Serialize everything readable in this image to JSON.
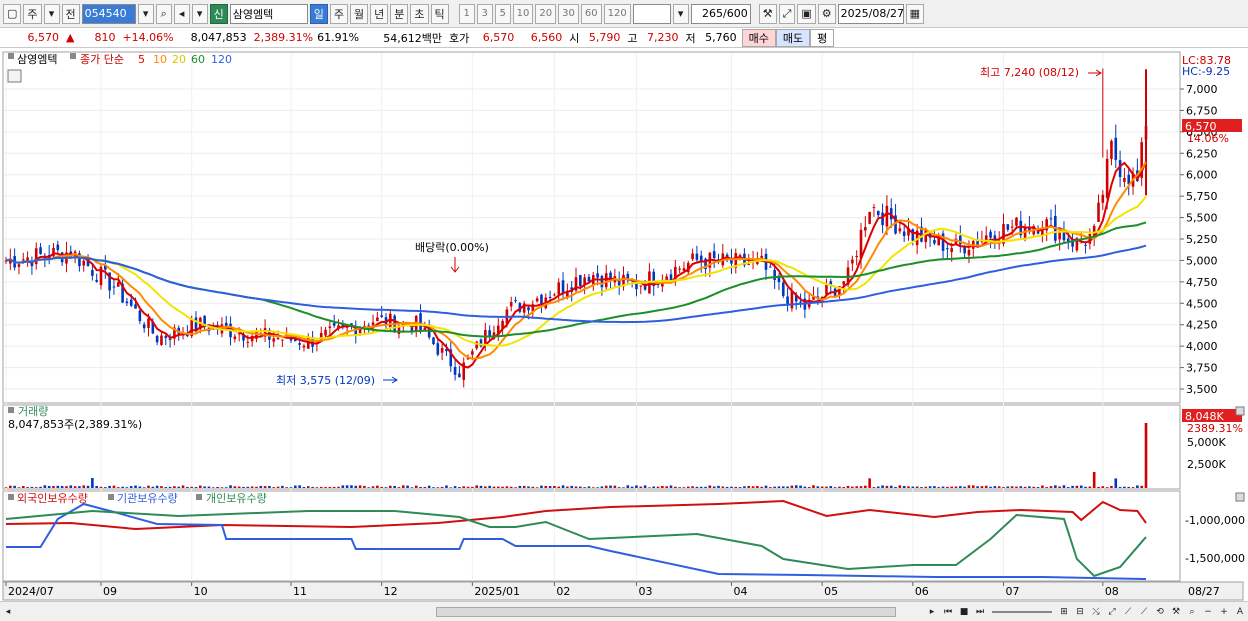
{
  "toolbar": {
    "market_label": "주",
    "all_label": "전",
    "stock_code": "054540",
    "new_badge": "신",
    "stock_name": "삼영엠텍",
    "periods": [
      "일",
      "주",
      "월",
      "년",
      "분",
      "초",
      "틱"
    ],
    "active_period": "일",
    "intervals": [
      "1",
      "3",
      "5",
      "10",
      "20",
      "30",
      "60",
      "120"
    ],
    "count_value": "265",
    "count_max": "/600",
    "date_value": "2025/08/27",
    "icons": [
      "window-icon",
      "dropdown-icon",
      "search-icon",
      "speaker-icon",
      "tools-icon",
      "draw-icon",
      "save-icon",
      "gear-icon",
      "calendar-icon"
    ]
  },
  "quote": {
    "price": "6,570",
    "change_arrow": "▲",
    "change": "810",
    "change_pct": "+14.06%",
    "volume": "8,047,853",
    "volume_ratio": "2,389.31%",
    "turnover": "61.91%",
    "amount": "54,612백만",
    "bid_label": "호가",
    "ask_price": "6,570",
    "bid_price": "6,560",
    "open_label": "시",
    "open": "5,790",
    "high_label": "고",
    "high": "7,230",
    "low_label": "저",
    "low": "5,760",
    "buy_label": "매수",
    "sell_label": "매도",
    "eval_label": "평"
  },
  "colors": {
    "up": "#d00000",
    "down": "#0036c0",
    "ma5": "#e00000",
    "ma10": "#ff8c00",
    "ma20": "#f2e400",
    "ma60": "#1a8f2a",
    "ma120": "#2f5fe0",
    "foreign": "#d01010",
    "institution": "#2f5fe0",
    "individual": "#2e8b57",
    "current_price_bg": "#e02020"
  },
  "price_panel": {
    "stock_label": "삼영엠텍",
    "ma_prefix": "종가 단순",
    "ma_periods": [
      "5",
      "10",
      "20",
      "60",
      "120"
    ],
    "lc_label": "LC:83.78",
    "hc_label": "HC:-9.25",
    "high_annotation": "최고 7,240 (08/12)",
    "low_annotation": "최저 3,575 (12/09)",
    "dividend_annotation": "배당락(0.00%)",
    "current_price": "6,570",
    "current_change": "14.06%",
    "y_ticks": [
      "7,000",
      "6,750",
      "6,500",
      "6,250",
      "6,000",
      "5,750",
      "5,500",
      "5,250",
      "5,000",
      "4,750",
      "4,500",
      "4,250",
      "4,000",
      "3,750",
      "3,500"
    ]
  },
  "volume_panel": {
    "title": "거래량",
    "value_label": "8,047,853주(2,389.31%)",
    "current": "8,048K",
    "current_pct": "2389.31%",
    "y_ticks": [
      "5,000K",
      "2,500K"
    ]
  },
  "holdings_panel": {
    "foreign_label": "외국인보유수량",
    "institution_label": "기관보유수량",
    "individual_label": "개인보유수량",
    "y_ticks": [
      "-1,000,000",
      "-1,500,000"
    ]
  },
  "x_axis": {
    "labels": [
      "2024/07",
      "09",
      "10",
      "11",
      "12",
      "2025/01",
      "02",
      "03",
      "04",
      "05",
      "06",
      "07",
      "08"
    ],
    "last_date": "08/27"
  },
  "chart_data": {
    "type": "line",
    "title": "",
    "x": [
      "2024/07",
      "09",
      "10",
      "11",
      "12",
      "2025/01",
      "02",
      "03",
      "04",
      "05",
      "06",
      "07",
      "08",
      "08/27"
    ],
    "series": [
      {
        "name": "종가",
        "values": [
          5000,
          4300,
          4150,
          4300,
          3650,
          4550,
          4850,
          5000,
          4500,
          5700,
          5300,
          5250,
          6600,
          6570
        ]
      }
    ],
    "ylim": [
      3400,
      7300
    ]
  }
}
